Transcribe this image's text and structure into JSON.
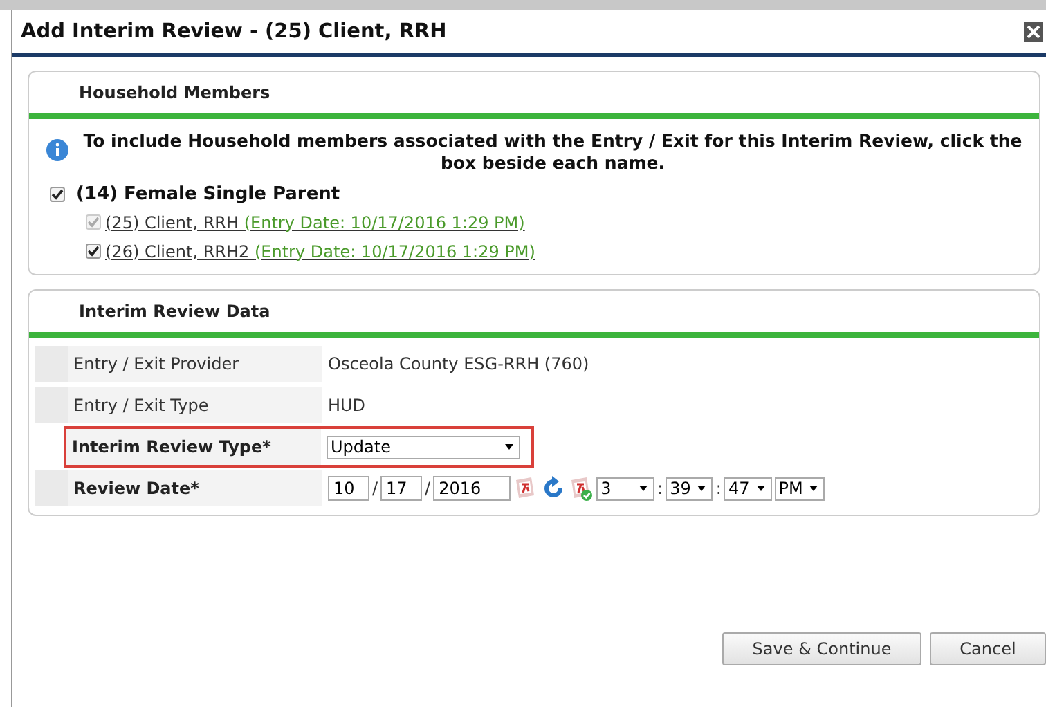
{
  "window": {
    "title": "Add Interim Review - (25) Client, RRH"
  },
  "household": {
    "title": "Household Members",
    "info": "To include Household members associated with the Entry / Exit for this Interim Review, click the box beside each name.",
    "group": {
      "label": "(14) Female Single Parent",
      "checked": true
    },
    "members": [
      {
        "name": "(25) Client, RRH",
        "entry": "(Entry Date: 10/17/2016 1:29 PM)",
        "checked": true,
        "disabled": true
      },
      {
        "name": "(26) Client, RRH2",
        "entry": "(Entry Date: 10/17/2016 1:29 PM)",
        "checked": true,
        "disabled": false
      }
    ]
  },
  "review": {
    "title": "Interim Review Data",
    "rows": [
      {
        "kind": "text",
        "label": "Entry / Exit Provider",
        "value": "Osceola County ESG-RRH (760)"
      },
      {
        "kind": "text",
        "label": "Entry / Exit Type",
        "value": "HUD"
      },
      {
        "kind": "select",
        "label": "Interim Review Type",
        "required_mark": "*",
        "value": "Update",
        "highlighted": true
      },
      {
        "kind": "date",
        "label": "Review Date",
        "required_mark": "*",
        "separators": [
          "/",
          "/",
          ":",
          ":"
        ],
        "month": "10",
        "day": "17",
        "year": "2016",
        "hour": "3",
        "minute": "39",
        "second": "47",
        "ampm": "PM",
        "highlighted": false
      }
    ]
  },
  "buttons": [
    "Save & Continue",
    "Cancel"
  ]
}
